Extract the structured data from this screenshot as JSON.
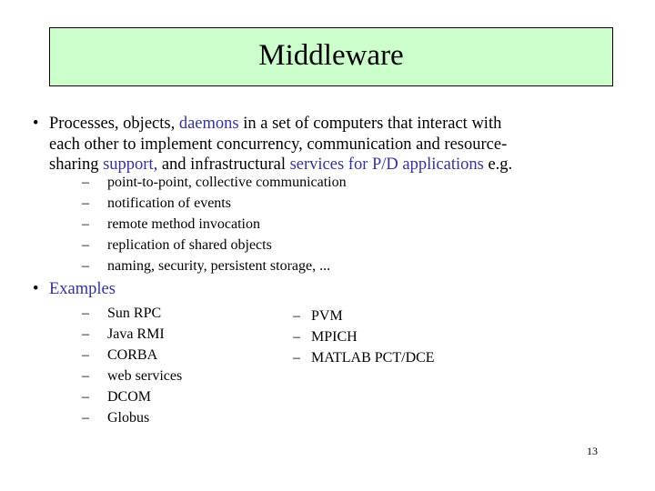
{
  "slide": {
    "title": "Middleware",
    "page_number": "13",
    "colors": {
      "title_fill": "#ccffcc",
      "title_border": "#000000",
      "accent_text": "#333399"
    },
    "bullet1": {
      "marker": "•",
      "line1": {
        "a": "Processes, objects, ",
        "b": "daemons",
        "c": " in a set of computers that interact with"
      },
      "line2": "each other to implement concurrency, communication and resource-",
      "line3": {
        "a": "sharing ",
        "b": "support,",
        "c": " and infrastructural ",
        "d": "services for P/D applications",
        "e": " e.g."
      },
      "subitems": [
        {
          "marker": "–",
          "label": "point-to-point, collective communication"
        },
        {
          "marker": "–",
          "label": "notification of events"
        },
        {
          "marker": "–",
          "label": "remote method invocation"
        },
        {
          "marker": "–",
          "label": "replication of shared objects"
        },
        {
          "marker": "–",
          "label": "naming, security, persistent storage, ..."
        }
      ]
    },
    "bullet2": {
      "marker": "•",
      "label": "Examples",
      "left_column": [
        {
          "marker": "–",
          "label": "Sun RPC"
        },
        {
          "marker": "–",
          "label": "Java RMI"
        },
        {
          "marker": "–",
          "label": "CORBA"
        },
        {
          "marker": "–",
          "label": "web services"
        },
        {
          "marker": "–",
          "label": "DCOM"
        },
        {
          "marker": "–",
          "label": "Globus"
        }
      ],
      "right_column": [
        {
          "marker": "–",
          "label": "PVM"
        },
        {
          "marker": "–",
          "label": "MPICH"
        },
        {
          "marker": "–",
          "label": "MATLAB PCT/DCE"
        }
      ]
    }
  }
}
